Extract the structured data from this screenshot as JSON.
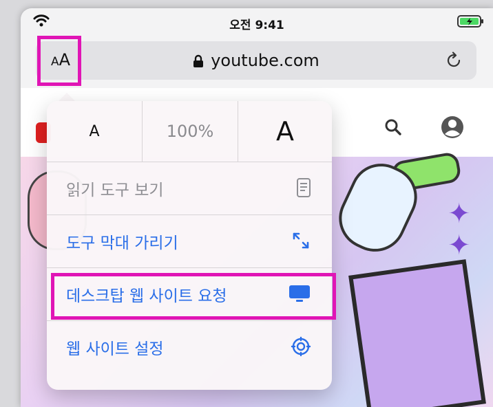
{
  "status": {
    "time": "오전 9:41"
  },
  "addressbar": {
    "aa_small": "A",
    "aa_large": "A",
    "url": "youtube.com"
  },
  "popover": {
    "font_small": "A",
    "zoom": "100%",
    "font_large": "A",
    "items": [
      {
        "label": "읽기 도구 보기",
        "icon": "reader-icon",
        "enabled": false
      },
      {
        "label": "도구 막대 가리기",
        "icon": "arrows-expand-icon",
        "enabled": true
      },
      {
        "label": "데스크탑 웹 사이트 요청",
        "icon": "desktop-icon",
        "enabled": true
      },
      {
        "label": "웹 사이트 설정",
        "icon": "gear-icon",
        "enabled": true
      }
    ]
  },
  "colors": {
    "accent": "#2a6ee8",
    "highlight": "#e015b5"
  }
}
